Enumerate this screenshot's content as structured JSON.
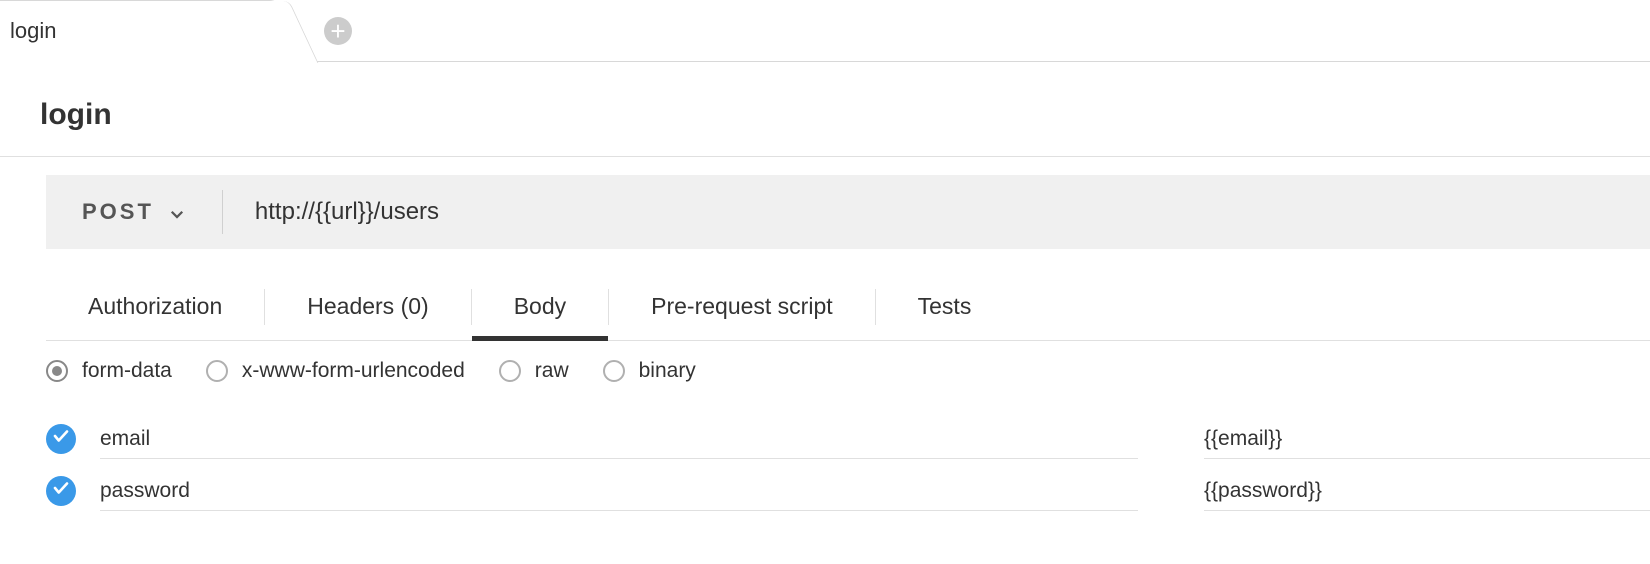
{
  "tabs": {
    "active": "login"
  },
  "request": {
    "title": "login",
    "method": "POST",
    "url": "http://{{url}}/users"
  },
  "subtabs": [
    {
      "label": "Authorization",
      "active": false
    },
    {
      "label": "Headers (0)",
      "active": false
    },
    {
      "label": "Body",
      "active": true
    },
    {
      "label": "Pre-request script",
      "active": false
    },
    {
      "label": "Tests",
      "active": false
    }
  ],
  "bodyTypes": [
    {
      "label": "form-data",
      "selected": true
    },
    {
      "label": "x-www-form-urlencoded",
      "selected": false
    },
    {
      "label": "raw",
      "selected": false
    },
    {
      "label": "binary",
      "selected": false
    }
  ],
  "params": [
    {
      "enabled": true,
      "key": "email",
      "value": "{{email}}"
    },
    {
      "enabled": true,
      "key": "password",
      "value": "{{password}}"
    }
  ]
}
